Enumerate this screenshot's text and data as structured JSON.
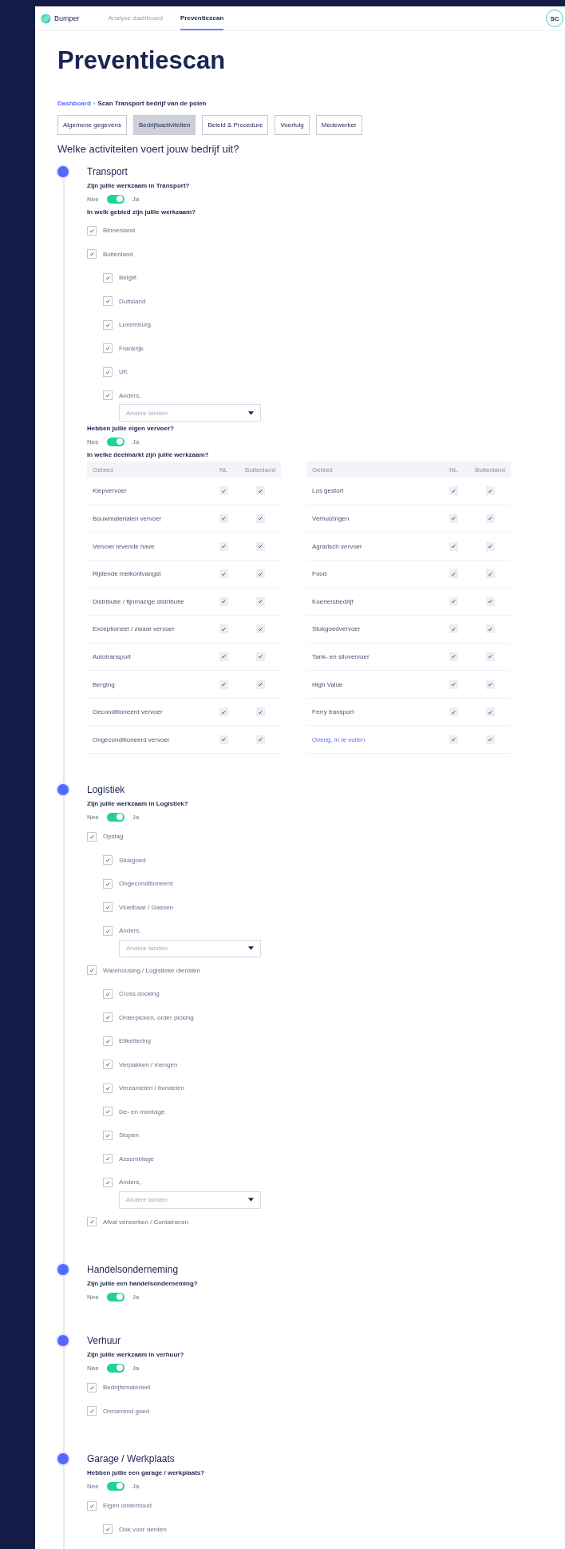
{
  "header": {
    "logo": "Bumper",
    "nav": [
      {
        "label": "Analyse dashboard",
        "selected": false
      },
      {
        "label": "Preventiescan",
        "selected": true
      }
    ],
    "avatar": "SC"
  },
  "title": "Preventiescan",
  "breadcrumb": {
    "separator": "›",
    "items": [
      {
        "label": "Dashboard",
        "link": true
      },
      {
        "label": "Scan Transport bedrijf van de polen",
        "link": false
      }
    ]
  },
  "tabs": [
    {
      "label": "Algemene gegevens",
      "selected": false
    },
    {
      "label": "Bedrijfsactiviteiten",
      "selected": true
    },
    {
      "label": "Beleid & Procedure",
      "selected": false
    },
    {
      "label": "Voertuig",
      "selected": false
    },
    {
      "label": "Medewerker",
      "selected": false
    }
  ],
  "heading": "Welke activiteiten voert jouw bedrijf uit?",
  "sections": [
    {
      "title": "Transport",
      "blocks": [
        {
          "kind": "question",
          "text": "Zijn jullie werkzaam in Transport?"
        },
        {
          "kind": "toggle",
          "off_label": "Nee",
          "on_label": "Ja",
          "on": true
        },
        {
          "kind": "question",
          "text": "In welk gebied zijn jullie werkzaam?"
        },
        {
          "kind": "checkbox",
          "label": "Binnenland",
          "checked": true
        },
        {
          "kind": "checkbox",
          "label": "Buitenland",
          "checked": true,
          "children": [
            {
              "label": "België",
              "checked": true
            },
            {
              "label": "Duitsland",
              "checked": true
            },
            {
              "label": "Luxemburg",
              "checked": true
            },
            {
              "label": "Frankrijk",
              "checked": true
            },
            {
              "label": "UK",
              "checked": true
            },
            {
              "label": "Anders,",
              "checked": true,
              "dropdown": {
                "placeholder": "Andere landen"
              }
            }
          ]
        },
        {
          "kind": "question",
          "text": "Hebben jullie eigen vervoer?"
        },
        {
          "kind": "toggle",
          "off_label": "Nee",
          "on_label": "Ja",
          "on": true
        },
        {
          "kind": "question",
          "text": "In welke deelmarkt zijn jullie werkzaam?"
        },
        {
          "kind": "table",
          "tables": [
            {
              "columns": [
                "Gebied",
                "NL",
                "Buitenland"
              ],
              "rows": [
                {
                  "label": "Kiepvervoer",
                  "link": false,
                  "nl": true,
                  "abroad": true
                },
                {
                  "label": "Bouwmaterialen vervoer",
                  "link": false,
                  "nl": true,
                  "abroad": true
                },
                {
                  "label": "Vervoer levende have",
                  "link": false,
                  "nl": true,
                  "abroad": true
                },
                {
                  "label": "Rijdende melkontvangst",
                  "link": false,
                  "nl": true,
                  "abroad": true
                },
                {
                  "label": "Distributie / fijnmazige distributie",
                  "link": false,
                  "nl": true,
                  "abroad": true
                },
                {
                  "label": "Exceptioneel / zwaar vervoer",
                  "link": false,
                  "nl": true,
                  "abroad": true
                },
                {
                  "label": "Autotransport",
                  "link": false,
                  "nl": true,
                  "abroad": true
                },
                {
                  "label": "Berging",
                  "link": false,
                  "nl": true,
                  "abroad": true
                },
                {
                  "label": "Geconditioneerd vervoer",
                  "link": false,
                  "nl": true,
                  "abroad": true
                },
                {
                  "label": "Ongeconditioneerd vervoer",
                  "link": false,
                  "nl": true,
                  "abroad": true
                }
              ]
            },
            {
              "columns": [
                "Gebied",
                "NL",
                "Buitenland"
              ],
              "rows": [
                {
                  "label": "Los gestort",
                  "link": false,
                  "nl": true,
                  "abroad": true
                },
                {
                  "label": "Verhuizingen",
                  "link": false,
                  "nl": true,
                  "abroad": true
                },
                {
                  "label": "Agrarisch vervoer",
                  "link": false,
                  "nl": true,
                  "abroad": true
                },
                {
                  "label": "Food",
                  "link": false,
                  "nl": true,
                  "abroad": true
                },
                {
                  "label": "Koeriersbedrijf",
                  "link": false,
                  "nl": true,
                  "abroad": true
                },
                {
                  "label": "Stukgoedvervoer",
                  "link": false,
                  "nl": true,
                  "abroad": true
                },
                {
                  "label": "Tank- en silovervoer",
                  "link": false,
                  "nl": true,
                  "abroad": true
                },
                {
                  "label": "High Value",
                  "link": false,
                  "nl": true,
                  "abroad": true
                },
                {
                  "label": "Ferry transport",
                  "link": false,
                  "nl": true,
                  "abroad": true
                },
                {
                  "label": "Overig, in te vullen",
                  "link": true,
                  "nl": true,
                  "abroad": true
                }
              ]
            }
          ]
        }
      ]
    },
    {
      "title": "Logistiek",
      "blocks": [
        {
          "kind": "question",
          "text": "Zijn jullie werkzaam in Logistiek?"
        },
        {
          "kind": "toggle",
          "off_label": "Nee",
          "on_label": "Ja",
          "on": true
        },
        {
          "kind": "checkbox",
          "label": "Opslag",
          "checked": true,
          "children": [
            {
              "label": "Stukgoed",
              "checked": true
            },
            {
              "label": "Ongeconditioneerd",
              "checked": true
            },
            {
              "label": "Vloeibaar / Gassen",
              "checked": true
            },
            {
              "label": "Anders,",
              "checked": true,
              "dropdown": {
                "placeholder": "Andere landen"
              }
            }
          ]
        },
        {
          "kind": "checkbox",
          "label": "Warehousing / Logistieke diensten",
          "checked": true,
          "children": [
            {
              "label": "Cross docking",
              "checked": true
            },
            {
              "label": "Orderpicken, order picking",
              "checked": true
            },
            {
              "label": "Etikettering",
              "checked": true
            },
            {
              "label": "Verpakken / mengen",
              "checked": true
            },
            {
              "label": "Verzamelen / bundelen",
              "checked": true
            },
            {
              "label": "De- en montage",
              "checked": true
            },
            {
              "label": "Slopen",
              "checked": true
            },
            {
              "label": "Assemblage",
              "checked": true
            },
            {
              "label": "Anders,",
              "checked": true,
              "dropdown": {
                "placeholder": "Andere landen"
              }
            }
          ]
        },
        {
          "kind": "checkbox",
          "label": "Afval verwerken / Containeren",
          "checked": true
        }
      ]
    },
    {
      "title": "Handelsonderneming",
      "blocks": [
        {
          "kind": "question",
          "text": "Zijn jullie een handelsonderneming?"
        },
        {
          "kind": "toggle",
          "off_label": "Nee",
          "on_label": "Ja",
          "on": true
        }
      ]
    },
    {
      "title": "Verhuur",
      "blocks": [
        {
          "kind": "question",
          "text": "Zijn jullie werkzaam in verhuur?"
        },
        {
          "kind": "toggle",
          "off_label": "Nee",
          "on_label": "Ja",
          "on": true
        },
        {
          "kind": "checkbox",
          "label": "Bedrijfsmaterieel",
          "checked": true
        },
        {
          "kind": "checkbox",
          "label": "Onroerend goed",
          "checked": true
        }
      ]
    },
    {
      "title": "Garage / Werkplaats",
      "blocks": [
        {
          "kind": "question",
          "text": "Hebben jullie een garage / werkplaats?"
        },
        {
          "kind": "toggle",
          "off_label": "Nee",
          "on_label": "Ja",
          "on": true
        },
        {
          "kind": "checkbox",
          "label": "Eigen onderhoud",
          "checked": true,
          "children": [
            {
              "label": "Ook voor derden",
              "checked": true
            }
          ]
        }
      ]
    }
  ]
}
